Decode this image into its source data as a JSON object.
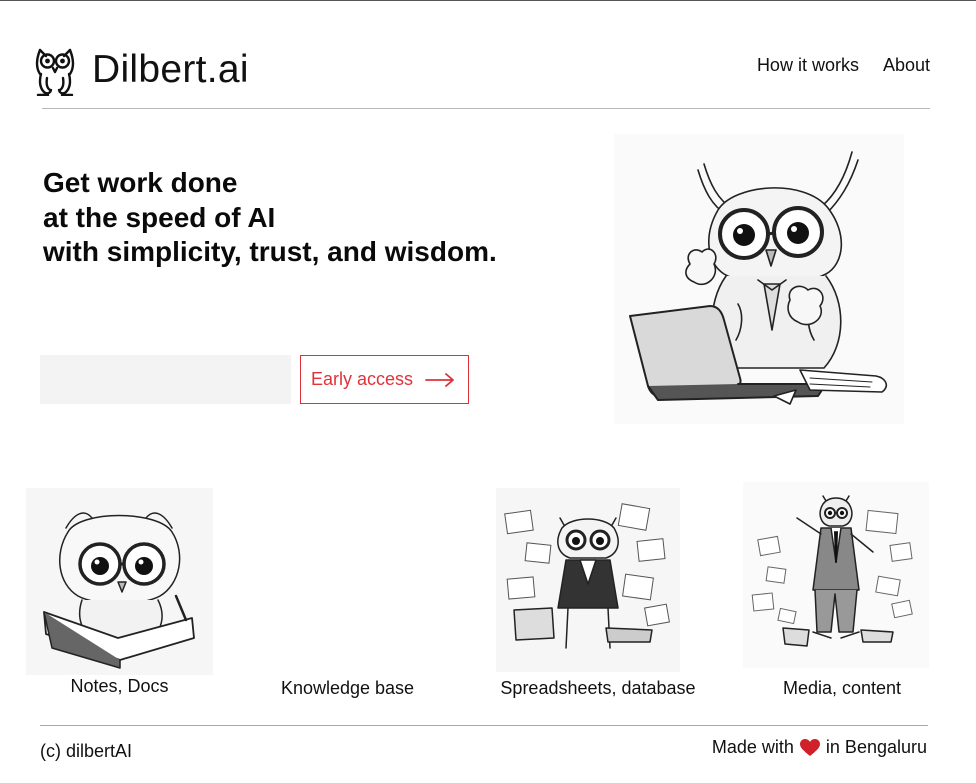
{
  "brand": {
    "name": "Dilbert.ai",
    "logo_icon": "owl-icon"
  },
  "nav": {
    "items": [
      {
        "label": "How it works"
      },
      {
        "label": "About"
      }
    ]
  },
  "hero": {
    "lines": [
      "Get work done",
      "at the speed of AI",
      "with simplicity, trust, and wisdom."
    ],
    "email_placeholder": "",
    "cta_label": "Early access",
    "accent_color": "#e0323b"
  },
  "features": [
    {
      "label": "Notes, Docs"
    },
    {
      "label": "Knowledge base"
    },
    {
      "label": "Spreadsheets, database"
    },
    {
      "label": "Media, content"
    }
  ],
  "footer": {
    "copyright": "(c) dilbertAI",
    "made_prefix": "Made with",
    "made_suffix": "in Bengaluru"
  }
}
